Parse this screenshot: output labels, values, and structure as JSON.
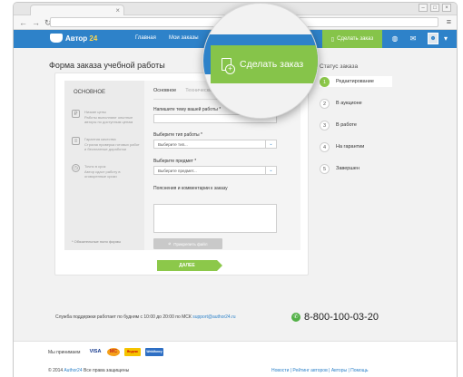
{
  "header": {
    "logo_text": "Автор",
    "logo_num": "24",
    "nav": [
      "Главная",
      "Мои заказы"
    ],
    "order_button": "Сделать заказ"
  },
  "page": {
    "title": "Форма заказа учебной работы"
  },
  "magnifier": {
    "button_label": "Сделать заказ"
  },
  "steps": {
    "title": "Статус заказа",
    "items": [
      {
        "num": "1",
        "label": "Редактирование"
      },
      {
        "num": "2",
        "label": "В аукционе"
      },
      {
        "num": "3",
        "label": "В работе"
      },
      {
        "num": "4",
        "label": "На гарантии"
      },
      {
        "num": "5",
        "label": "Завершен"
      }
    ]
  },
  "form": {
    "aside_title": "ОСНОВНОЕ",
    "aside_items": [
      {
        "title": "Низкие цены",
        "text": "Работы выполняют опытные авторы по доступным ценам"
      },
      {
        "title": "Гарантия качества",
        "text": "Строгая проверка готовых работ и бесплатные доработки"
      },
      {
        "title": "Точно в срок",
        "text": "Автор сдаст работу в оговоренные сроки"
      }
    ],
    "required_note": "* Обязательные поля формы",
    "tabs": [
      "Основное",
      "Технические характеристики"
    ],
    "topic_label": "Напишите тему вашей работы *",
    "type_label": "Выберите тип работы *",
    "type_placeholder": "Выберите тип...",
    "subject_label": "Выберите предмет *",
    "subject_placeholder": "Выберите предмет...",
    "comment_label": "Пояснения и комментарии к заказу",
    "attach_button": "Прикрепить файл",
    "next_button": "ДАЛЕЕ"
  },
  "support": {
    "text": "Служба поддержки работает по будням с 10:00 до 20:00 по МСК",
    "email": "support@author24.ru",
    "phone": "8-800-100-03-20"
  },
  "footer": {
    "pay_label": "Мы принимаем",
    "payments": [
      "VISA",
      "MC",
      "Яндекс",
      "WebMoney"
    ],
    "copyright_year": "© 2014",
    "copyright_brand": "Author24",
    "copyright_text": "Все права защищены",
    "links": "Новости  |  Рейтинг авторов  |  Авторы  |  Помощь"
  }
}
